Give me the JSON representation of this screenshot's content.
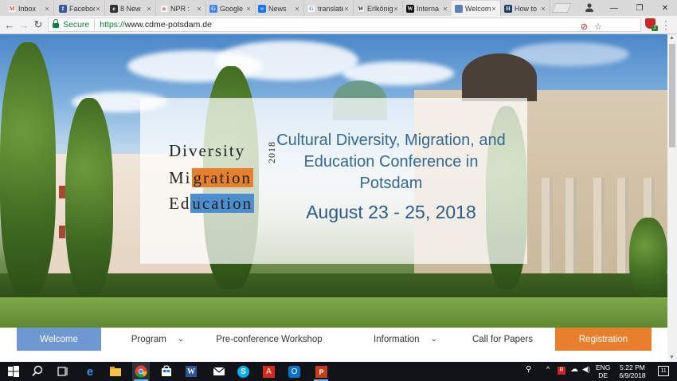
{
  "browser": {
    "tabs": [
      {
        "title": "Inbox",
        "icon": "gmail-icon",
        "color": "#ffffff",
        "glyph": "M",
        "glyph_color": "#d93025"
      },
      {
        "title": "Facebook",
        "icon": "facebook-icon",
        "color": "#3b5998",
        "glyph": "f",
        "glyph_color": "#ffffff"
      },
      {
        "title": "8 New",
        "icon": "eight-icon",
        "color": "#333333",
        "glyph": "e",
        "glyph_color": "#ffffff"
      },
      {
        "title": "NPR :",
        "icon": "npr-icon",
        "color": "#ffffff",
        "glyph": "n",
        "glyph_color": "#d62021"
      },
      {
        "title": "Google",
        "icon": "google-docs-icon",
        "color": "#4285f4",
        "glyph": "G",
        "glyph_color": "#ffffff"
      },
      {
        "title": "News",
        "icon": "news-icon",
        "color": "#1a73e8",
        "glyph": "∞",
        "glyph_color": "#ffffff"
      },
      {
        "title": "translate",
        "icon": "google-icon",
        "color": "#ffffff",
        "glyph": "G",
        "glyph_color": "#4285f4"
      },
      {
        "title": "Erlkönig",
        "icon": "wikipedia-icon",
        "color": "#ffffff",
        "glyph": "W",
        "glyph_color": "#111111"
      },
      {
        "title": "Interna",
        "icon": "wikipedia-dark-icon",
        "color": "#111111",
        "glyph": "W",
        "glyph_color": "#ffffff"
      },
      {
        "title": "Welcome",
        "icon": "page-icon",
        "color": "#5b7fb8",
        "glyph": "",
        "glyph_color": "#ffffff",
        "active": true
      },
      {
        "title": "How to",
        "icon": "howto-icon",
        "color": "#1c3d6e",
        "glyph": "H",
        "glyph_color": "#ffffff"
      }
    ],
    "close_glyph": "×",
    "window_controls": {
      "minimize": "—",
      "maximize": "❐",
      "close": "✕"
    },
    "address": {
      "secure_label": "Secure",
      "url_scheme": "https://",
      "url_host": "www.cdme-potsdam.de"
    },
    "ext_badge": "1"
  },
  "site": {
    "logo": {
      "line1": "Diversity",
      "line2_pre": "Mi",
      "line2_hl": "gration",
      "line3_pre": "Ed",
      "line3_hl": "ucation",
      "year": "2018"
    },
    "title": "Cultural Diversity, Migration, and Education Conference in Potsdam",
    "date": "August 23 - 25, 2018",
    "nav": [
      {
        "label": "Welcome",
        "dropdown": false
      },
      {
        "label": "Program",
        "dropdown": true
      },
      {
        "label": "Pre-conference Workshop",
        "dropdown": false
      },
      {
        "label": "Information",
        "dropdown": true
      },
      {
        "label": "Call for Papers",
        "dropdown": false
      },
      {
        "label": "Registration",
        "dropdown": false
      }
    ],
    "colors": {
      "accent_blue": "#6f97d1",
      "accent_orange": "#e87f2c",
      "title_blue": "#35678f"
    }
  },
  "taskbar": {
    "lang_line1": "ENG",
    "lang_line2": "DE",
    "time": "5:22 PM",
    "date": "6/9/2018",
    "notifications": "11",
    "apps": [
      "windows-icon",
      "search-icon",
      "task-view-icon",
      "edge-icon",
      "file-explorer-icon",
      "chrome-icon",
      "store-icon",
      "word-icon",
      "mail-icon",
      "skype-icon",
      "acrobat-icon",
      "outlook-icon",
      "powerpoint-icon"
    ]
  }
}
